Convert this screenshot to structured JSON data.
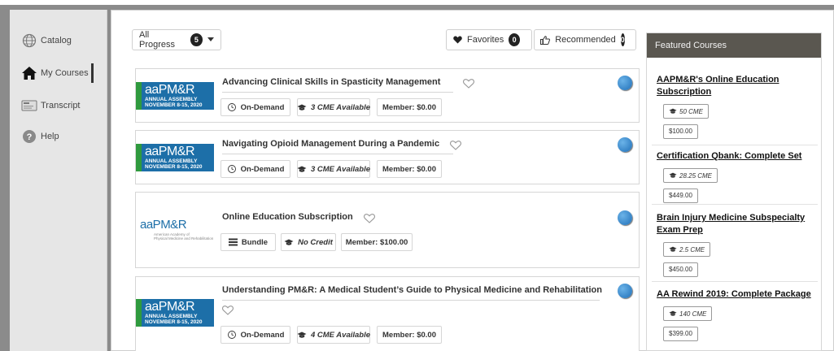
{
  "caption": "...ep       ...                       ...y",
  "sidebar": {
    "items": [
      {
        "label": "Catalog",
        "icon": "globe-icon"
      },
      {
        "label": "My Courses",
        "icon": "home-icon"
      },
      {
        "label": "Transcript",
        "icon": "transcript-icon"
      },
      {
        "label": "Help",
        "icon": "help-icon"
      }
    ],
    "active": "My Courses"
  },
  "filters": {
    "progress_label": "All Progress",
    "progress_count": "5",
    "favorites_label": "Favorites",
    "favorites_count": "0",
    "recommended_label": "Recommended",
    "recommended_count": "0"
  },
  "courses": [
    {
      "title": "Advancing Clinical Skills in Spasticity Management",
      "logo": {
        "big": "aaPM&R",
        "line1": "ANNUAL ASSEMBLY",
        "line2": "NOVEMBER 8-15, 2020",
        "side": "VIRTUAL"
      },
      "format": "On-Demand",
      "credit": "3 CME Available",
      "price": "Member: $0.00"
    },
    {
      "title": "Navigating Opioid Management During a Pandemic",
      "logo": {
        "big": "aaPM&R",
        "line1": "ANNUAL ASSEMBLY",
        "line2": "NOVEMBER 8-15, 2020",
        "side": "VIRTUAL"
      },
      "format": "On-Demand",
      "credit": "3 CME Available",
      "price": "Member: $0.00"
    },
    {
      "title": "Online Education Subscription",
      "logo": {
        "big": "aaPM&R",
        "line1": "American Academy of",
        "line2": "Physical Medicine and Rehabilitation"
      },
      "format": "Bundle",
      "credit": "No Credit",
      "price": "Member: $100.00"
    },
    {
      "title": "Understanding PM&R: A Medical Student’s Guide to Physical Medicine and Rehabilitation",
      "logo": {
        "big": "aaPM&R",
        "line1": "ANNUAL ASSEMBLY",
        "line2": "NOVEMBER 8-15, 2020",
        "side": "VIRTUAL"
      },
      "format": "On-Demand",
      "credit": "4 CME Available",
      "price": "Member: $0.00"
    }
  ],
  "featured": {
    "header": "Featured Courses",
    "items": [
      {
        "title": "AAPM&R's Online Education Subscription",
        "credit": "50 CME",
        "price": "$100.00"
      },
      {
        "title": "Certification Qbank: Complete Set",
        "credit": "28.25 CME",
        "price": "$449.00"
      },
      {
        "title": "Brain Injury Medicine Subspecialty Exam Prep",
        "credit": "2.5 CME",
        "price": "$450.00"
      },
      {
        "title": "AA Rewind 2019: Complete Package",
        "credit": "140 CME",
        "price": "$399.00"
      }
    ]
  },
  "colors": {
    "frame": "#8b8b8b",
    "sidebar_bg": "#e6e6e6",
    "featured_header_bg": "#5a5750",
    "logo_blue": "#1d6fa8",
    "logo_green": "#2f9a3e",
    "status_blue": "#1f6fb8"
  }
}
